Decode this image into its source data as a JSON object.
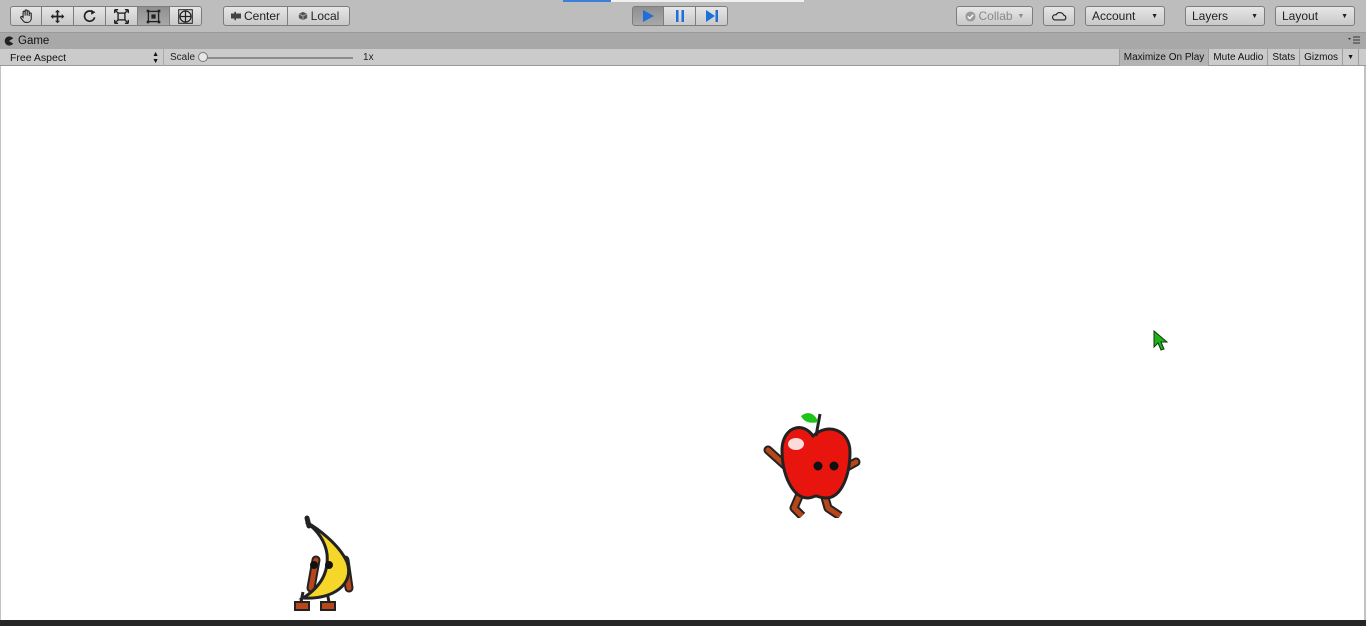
{
  "toolbar": {
    "tools": [
      {
        "name": "hand-tool",
        "icon": "hand-icon"
      },
      {
        "name": "move-tool",
        "icon": "move-icon"
      },
      {
        "name": "rotate-tool",
        "icon": "rotate-icon"
      },
      {
        "name": "scale-tool",
        "icon": "scale-icon"
      },
      {
        "name": "rect-tool",
        "icon": "rect-icon"
      },
      {
        "name": "transform-tool",
        "icon": "transform-icon"
      }
    ],
    "pivot_label": "Center",
    "space_label": "Local",
    "playback": {
      "play_icon": "play-icon",
      "pause_icon": "pause-icon",
      "step_icon": "step-icon",
      "state": "playing"
    },
    "collab_label": "Collab",
    "cloud_icon": "cloud-icon",
    "account_label": "Account",
    "layers_label": "Layers",
    "layout_label": "Layout"
  },
  "game_view": {
    "tab_label": "Game",
    "aspect_label": "Free Aspect",
    "scale_label": "Scale",
    "scale_value": "1x",
    "scale_fraction": 0,
    "maximize_label": "Maximize On Play",
    "mute_label": "Mute Audio",
    "stats_label": "Stats",
    "gizmos_label": "Gizmos"
  },
  "scene": {
    "characters": [
      {
        "name": "banana-character",
        "icon": "banana-icon"
      },
      {
        "name": "apple-character",
        "icon": "apple-icon"
      }
    ],
    "cursor_icon": "pointer-cursor-icon"
  },
  "colors": {
    "accent": "#1f6fd8",
    "banana": "#f5d629",
    "apple": "#e8140e",
    "leaf": "#21c21a",
    "limbs": "#b8461b",
    "cursor": "#1fb11a"
  }
}
